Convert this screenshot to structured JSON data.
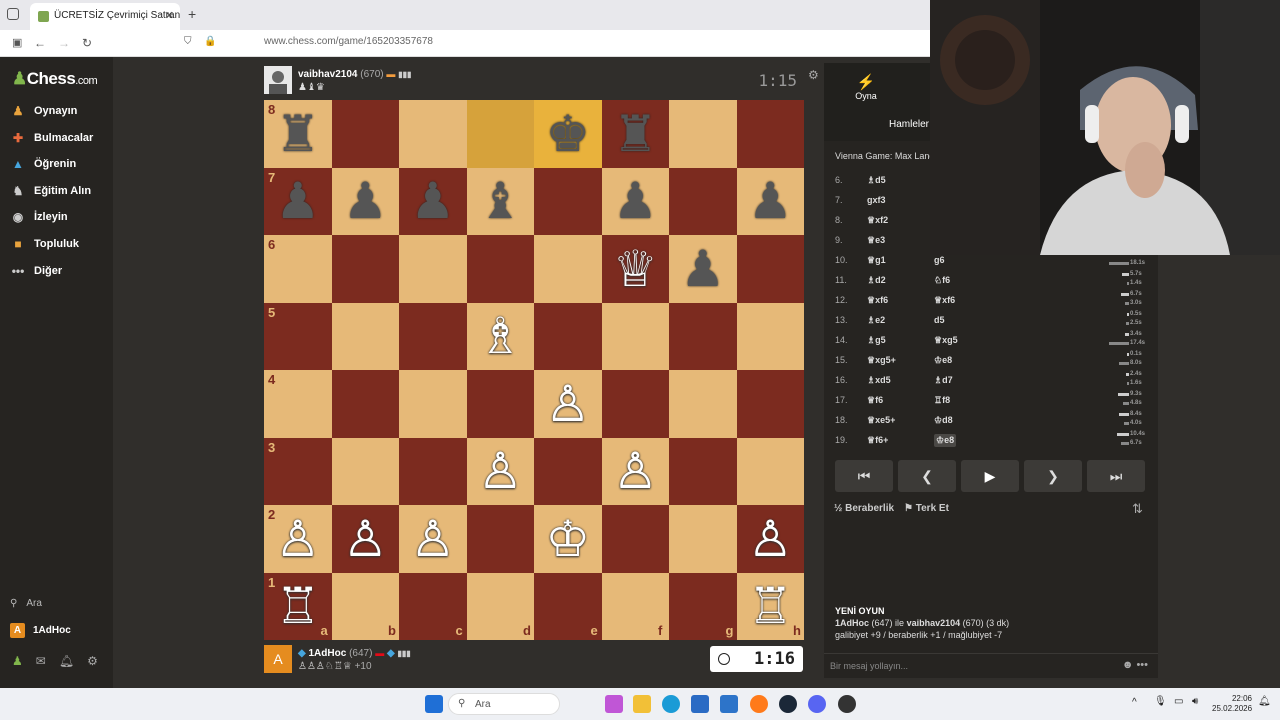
{
  "browser": {
    "tab_title": "ÜCRETSİZ Çevrimiçi Satranç",
    "url": "www.chess.com/game/165203357678"
  },
  "sidebar": {
    "logo": "Chess",
    "logo_suffix": ".com",
    "items": [
      {
        "label": "Oynayın",
        "icon": "pawn-play-icon",
        "color": "#e8a33d"
      },
      {
        "label": "Bulmacalar",
        "icon": "puzzle-icon",
        "color": "#e86a3d"
      },
      {
        "label": "Öğrenin",
        "icon": "graduation-cap-icon",
        "color": "#46a6de"
      },
      {
        "label": "Eğitim Alın",
        "icon": "coach-icon",
        "color": "#cccccc"
      },
      {
        "label": "İzleyin",
        "icon": "binoculars-icon",
        "color": "#cccccc"
      },
      {
        "label": "Topluluk",
        "icon": "community-icon",
        "color": "#e8a33d"
      },
      {
        "label": "Diğer",
        "icon": "more-dots-icon",
        "color": "#cccccc"
      }
    ],
    "search_label": "Ara",
    "user_initial": "A",
    "username": "1AdHoc"
  },
  "top_player": {
    "name": "vaibhav2104",
    "rating": "(670)",
    "captures": "♟♝♛",
    "clock": "1:15"
  },
  "bottom_player": {
    "name": "1AdHoc",
    "rating": "(647)",
    "captures": "♙♙♙♘♖♕",
    "advantage": "+10",
    "initial": "A",
    "clock": "1:16"
  },
  "board": {
    "files": [
      "a",
      "b",
      "c",
      "d",
      "e",
      "f",
      "g",
      "h"
    ],
    "ranks": [
      "8",
      "7",
      "6",
      "5",
      "4",
      "3",
      "2",
      "1"
    ],
    "highlight_squares": [
      "d8",
      "e8"
    ],
    "pieces": [
      {
        "sq": "a8",
        "p": "♜",
        "c": "b"
      },
      {
        "sq": "e8",
        "p": "♚",
        "c": "b"
      },
      {
        "sq": "f8",
        "p": "♜",
        "c": "b"
      },
      {
        "sq": "a7",
        "p": "♟",
        "c": "b"
      },
      {
        "sq": "b7",
        "p": "♟",
        "c": "b"
      },
      {
        "sq": "c7",
        "p": "♟",
        "c": "b"
      },
      {
        "sq": "d7",
        "p": "♝",
        "c": "b"
      },
      {
        "sq": "f7",
        "p": "♟",
        "c": "b"
      },
      {
        "sq": "h7",
        "p": "♟",
        "c": "b"
      },
      {
        "sq": "f6",
        "p": "♕",
        "c": "w"
      },
      {
        "sq": "g6",
        "p": "♟",
        "c": "b"
      },
      {
        "sq": "d5",
        "p": "♗",
        "c": "w"
      },
      {
        "sq": "e4",
        "p": "♙",
        "c": "w"
      },
      {
        "sq": "d3",
        "p": "♙",
        "c": "w"
      },
      {
        "sq": "f3",
        "p": "♙",
        "c": "w"
      },
      {
        "sq": "a2",
        "p": "♙",
        "c": "w"
      },
      {
        "sq": "b2",
        "p": "♙",
        "c": "w"
      },
      {
        "sq": "c2",
        "p": "♙",
        "c": "w"
      },
      {
        "sq": "e2",
        "p": "♔",
        "c": "w"
      },
      {
        "sq": "h2",
        "p": "♙",
        "c": "w"
      },
      {
        "sq": "a1",
        "p": "♖",
        "c": "w"
      },
      {
        "sq": "h1",
        "p": "♖",
        "c": "w"
      }
    ]
  },
  "panel": {
    "play_tab": "Oyna",
    "moves_tab": "Hamleler",
    "opening": "Vienna Game: Max Lange",
    "moves": [
      {
        "n": "6.",
        "w": "♗d5",
        "b": "",
        "tw": "",
        "tb": ""
      },
      {
        "n": "7.",
        "w": "gxf3",
        "b": "",
        "tw": "",
        "tb": ""
      },
      {
        "n": "8.",
        "w": "♕xf2",
        "b": "",
        "tw": "",
        "tb": ""
      },
      {
        "n": "9.",
        "w": "♕e3",
        "b": "",
        "tw": "",
        "tb": ""
      },
      {
        "n": "10.",
        "w": "♕g1",
        "b": "g6",
        "tw": "",
        "tb": "18.1s"
      },
      {
        "n": "11.",
        "w": "♗d2",
        "b": "♘f6",
        "tw": "5.7s",
        "tb": "1.4s"
      },
      {
        "n": "12.",
        "w": "♕xf6",
        "b": "♕xf6",
        "tw": "6.7s",
        "tb": "3.0s"
      },
      {
        "n": "13.",
        "w": "♗e2",
        "b": "d5",
        "tw": "0.5s",
        "tb": "2.5s"
      },
      {
        "n": "14.",
        "w": "♗g5",
        "b": "♕xg5",
        "tw": "3.4s",
        "tb": "17.4s"
      },
      {
        "n": "15.",
        "w": "♕xg5+",
        "b": "♔e8",
        "tw": "0.1s",
        "tb": "8.0s"
      },
      {
        "n": "16.",
        "w": "♗xd5",
        "b": "♗d7",
        "tw": "2.4s",
        "tb": "1.6s"
      },
      {
        "n": "17.",
        "w": "♕f6",
        "b": "♖f8",
        "tw": "9.3s",
        "tb": "4.8s"
      },
      {
        "n": "18.",
        "w": "♕xe5+",
        "b": "♔d8",
        "tw": "8.4s",
        "tb": "4.0s"
      },
      {
        "n": "19.",
        "w": "♕f6+",
        "b": "♔e8",
        "tw": "10.4s",
        "tb": "6.7s"
      }
    ],
    "draw_label": "Beraberlik",
    "resign_label": "Terk Et",
    "new_game_title": "YENİ OYUN",
    "new_game_line1_a": "1AdHoc",
    "new_game_line1_b": "(647) ile",
    "new_game_line1_c": "vaibhav2104",
    "new_game_line1_d": "(670) (3 dk)",
    "new_game_line2": "galibiyet +9 / beraberlik +1 / mağlubiyet -7",
    "chat_placeholder": "Bir mesaj yollayın..."
  },
  "taskbar": {
    "search": "Ara",
    "time": "22:06",
    "date": "25.02.2026"
  }
}
